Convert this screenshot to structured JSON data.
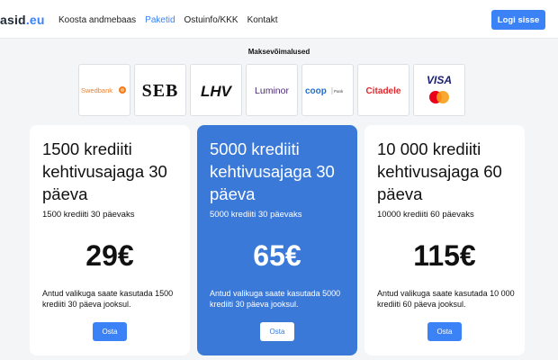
{
  "header": {
    "logo_main": "asid",
    "logo_tld": ".eu",
    "nav": [
      {
        "label": "Koosta andmebaas",
        "active": false
      },
      {
        "label": "Paketid",
        "active": true
      },
      {
        "label": "Ostuinfo/KKK",
        "active": false
      },
      {
        "label": "Kontakt",
        "active": false
      }
    ],
    "login_label": "Logi sisse"
  },
  "payments": {
    "title": "Maksevõimalused",
    "logos": [
      {
        "name": "Swedbank",
        "text": "Swedbank",
        "color": "#f47b20"
      },
      {
        "name": "SEB",
        "text": "SEB",
        "color": "#111111"
      },
      {
        "name": "LHV",
        "text": "LHV",
        "color": "#111111"
      },
      {
        "name": "Luminor",
        "text": "Luminor",
        "color": "#4a2c6e"
      },
      {
        "name": "Coop Pank",
        "text": "coop",
        "subtext": "Pank",
        "color": "#1f6fd1"
      },
      {
        "name": "Citadele",
        "text": "Citadele",
        "color": "#e3262a"
      },
      {
        "name": "Visa Mastercard",
        "text": "VISA",
        "color": "#1a1f71"
      }
    ]
  },
  "packages": [
    {
      "title": "1500 krediiti kehtivusajaga 30 päeva",
      "subtitle": "1500 krediiti 30 päevaks",
      "price": "29€",
      "description": "Antud valikuga saate kasutada 1500 krediiti 30 päeva jooksul.",
      "button": "Osta"
    },
    {
      "title": "5000 krediiti kehtivusajaga 30 päeva",
      "subtitle": "5000 krediiti 30 päevaks",
      "price": "65€",
      "description": "Antud valikuga saate kasutada 5000 krediiti 30 päeva jooksul.",
      "button": "Osta"
    },
    {
      "title": "10 000 krediiti kehtivusajaga 60 päeva",
      "subtitle": "10000 krediiti 60 päevaks",
      "price": "115€",
      "description": "Antud valikuga saate kasutada 10 000 krediiti 60 päeva jooksul.",
      "button": "Osta"
    }
  ],
  "colors": {
    "accent": "#3b82f6",
    "featured_card": "#3b79d8"
  }
}
